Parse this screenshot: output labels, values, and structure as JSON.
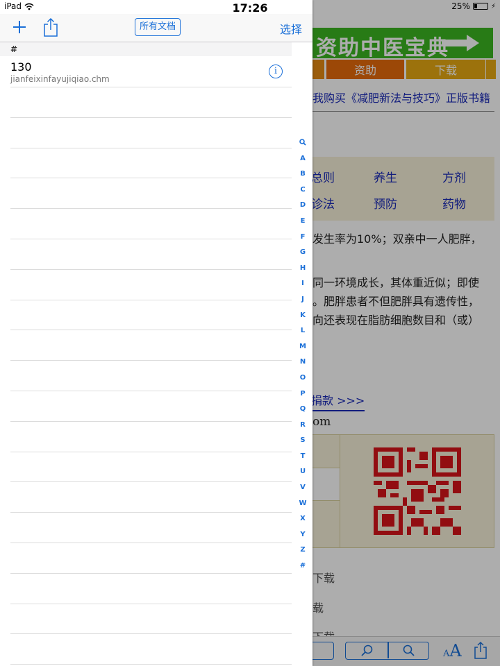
{
  "status": {
    "device": "iPad",
    "time": "17:26",
    "battery": "25%",
    "battery_level": 0.25
  },
  "toolbar": {
    "all_docs_label": "所有文档",
    "select_label": "选择"
  },
  "section": {
    "header": "#"
  },
  "documents": [
    {
      "title": "130",
      "filename": "jianfeixinfayujiqiao.chm"
    }
  ],
  "index_letters": [
    "A",
    "B",
    "C",
    "D",
    "E",
    "F",
    "G",
    "H",
    "I",
    "J",
    "K",
    "L",
    "M",
    "N",
    "O",
    "P",
    "Q",
    "R",
    "S",
    "T",
    "U",
    "V",
    "W",
    "X",
    "Y",
    "Z",
    "#"
  ],
  "reader": {
    "banner": "资助中医宝典",
    "nav": [
      "资助",
      "下载"
    ],
    "buy_link": "我购买《减肥新法与技巧》正版书籍",
    "categories": [
      "总则",
      "养生",
      "方剂",
      "诊法",
      "预防",
      "药物"
    ],
    "text_lines": [
      "发生率为10%；双亲中一人肥胖，",
      "同一环境成长，其体重近似；即使",
      "。肥胖患者不但肥胖具有遗传性，",
      "向还表现在脂肪细胞数目和（或）"
    ],
    "donate_link": "捐款 >>>",
    "domain_fragment": "om",
    "download_lines": [
      "下载",
      "载",
      "下载"
    ]
  },
  "colors": {
    "accent": "#1a6fd8",
    "banner_green": "#3cb521",
    "link_blue": "#1a2ab8"
  }
}
